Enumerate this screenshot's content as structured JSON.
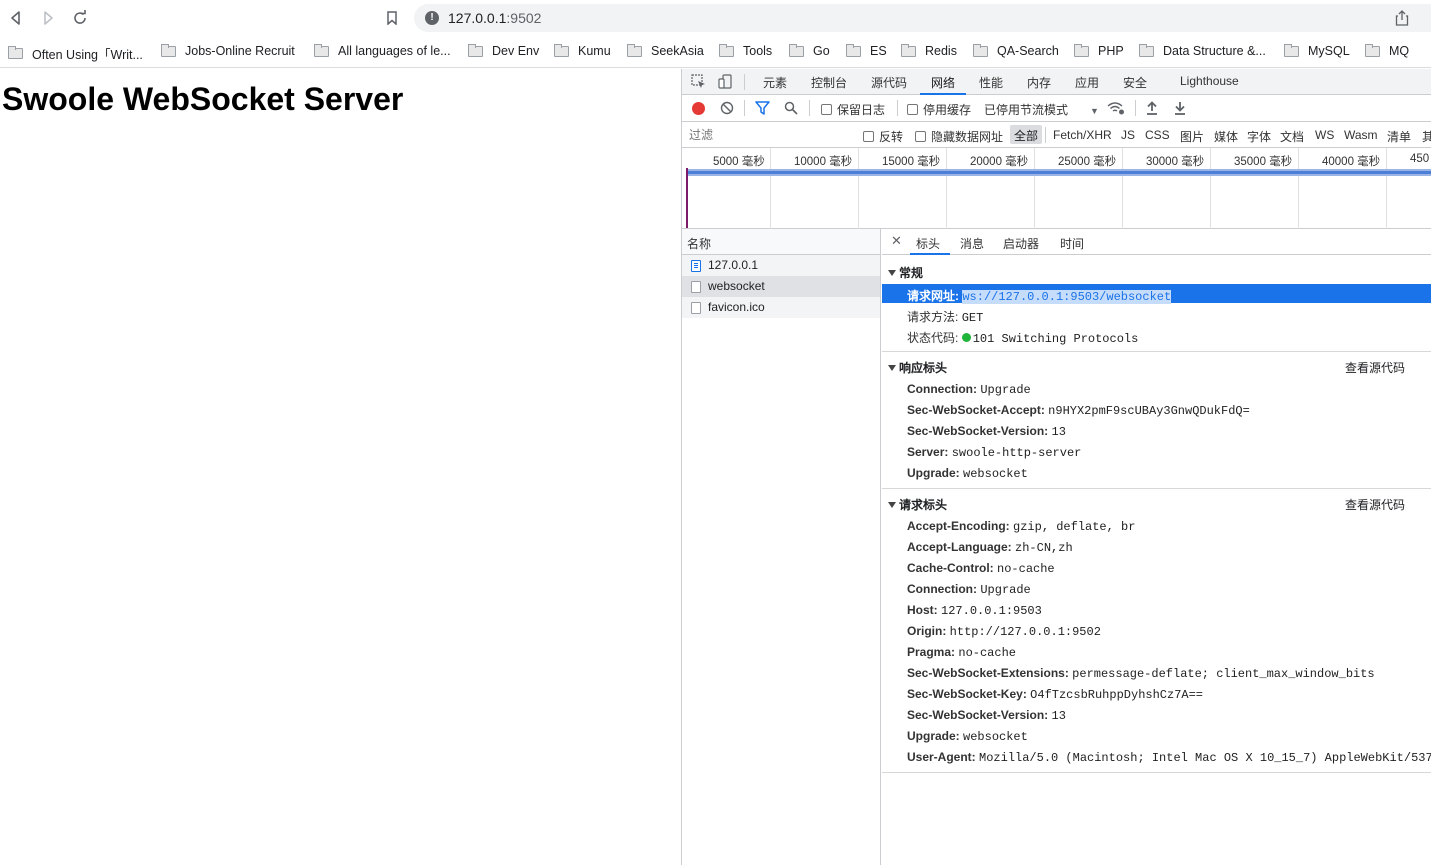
{
  "browser": {
    "url_host": "127.0.0.1",
    "url_port": ":9502",
    "bookmarks": [
      "Often Using「Writ...",
      "Jobs-Online Recruit",
      "All languages of le...",
      "Dev Env",
      "Kumu",
      "SeekAsia",
      "Tools",
      "Go",
      "ES",
      "Redis",
      "QA-Search",
      "PHP",
      "Data Structure &...",
      "MySQL",
      "MQ"
    ]
  },
  "page": {
    "heading": "Swoole WebSocket Server"
  },
  "devtools": {
    "tabs": [
      "元素",
      "控制台",
      "源代码",
      "网络",
      "性能",
      "内存",
      "应用",
      "安全",
      "Lighthouse"
    ],
    "active_tab": "网络",
    "toolbar": {
      "preserve_log": "保留日志",
      "disable_cache": "停用缓存",
      "throttling": "已停用节流模式"
    },
    "filter": {
      "placeholder": "过滤",
      "invert": "反转",
      "hide_data_urls": "隐藏数据网址",
      "types": [
        "全部",
        "Fetch/XHR",
        "JS",
        "CSS",
        "图片",
        "媒体",
        "字体",
        "文档",
        "WS",
        "Wasm",
        "清单",
        "其"
      ]
    },
    "timeline_ticks": [
      "5000 毫秒",
      "10000 毫秒",
      "15000 毫秒",
      "20000 毫秒",
      "25000 毫秒",
      "30000 毫秒",
      "35000 毫秒",
      "40000 毫秒",
      "450"
    ],
    "requests": {
      "column_name": "名称",
      "rows": [
        "127.0.0.1",
        "websocket",
        "favicon.ico"
      ]
    },
    "detail": {
      "tabs": [
        "标头",
        "消息",
        "启动器",
        "时间"
      ],
      "general": {
        "title": "常规",
        "request_url_key": "请求网址:",
        "request_url": "ws://127.0.0.1:9503/websocket",
        "method_key": "请求方法:",
        "method": "GET",
        "status_key": "状态代码:",
        "status": "101 Switching Protocols"
      },
      "response_headers": {
        "title": "响应标头",
        "view_source": "查看源代码",
        "rows": [
          {
            "k": "Connection:",
            "v": "Upgrade"
          },
          {
            "k": "Sec-WebSocket-Accept:",
            "v": "n9HYX2pmF9scUBAy3GnwQDukFdQ="
          },
          {
            "k": "Sec-WebSocket-Version:",
            "v": "13"
          },
          {
            "k": "Server:",
            "v": "swoole-http-server"
          },
          {
            "k": "Upgrade:",
            "v": "websocket"
          }
        ]
      },
      "request_headers": {
        "title": "请求标头",
        "view_source": "查看源代码",
        "rows": [
          {
            "k": "Accept-Encoding:",
            "v": "gzip, deflate, br"
          },
          {
            "k": "Accept-Language:",
            "v": "zh-CN,zh"
          },
          {
            "k": "Cache-Control:",
            "v": "no-cache"
          },
          {
            "k": "Connection:",
            "v": "Upgrade"
          },
          {
            "k": "Host:",
            "v": "127.0.0.1:9503"
          },
          {
            "k": "Origin:",
            "v": "http://127.0.0.1:9502"
          },
          {
            "k": "Pragma:",
            "v": "no-cache"
          },
          {
            "k": "Sec-WebSocket-Extensions:",
            "v": "permessage-deflate; client_max_window_bits"
          },
          {
            "k": "Sec-WebSocket-Key:",
            "v": "O4fTzcsbRuhppDyhshCz7A=="
          },
          {
            "k": "Sec-WebSocket-Version:",
            "v": "13"
          },
          {
            "k": "Upgrade:",
            "v": "websocket"
          },
          {
            "k": "User-Agent:",
            "v": "Mozilla/5.0 (Macintosh; Intel Mac OS X 10_15_7) AppleWebKit/537"
          }
        ]
      }
    }
  },
  "colors": {
    "accent": "#1a73e8",
    "status_ok": "#1eb53a",
    "record": "#e53935"
  }
}
